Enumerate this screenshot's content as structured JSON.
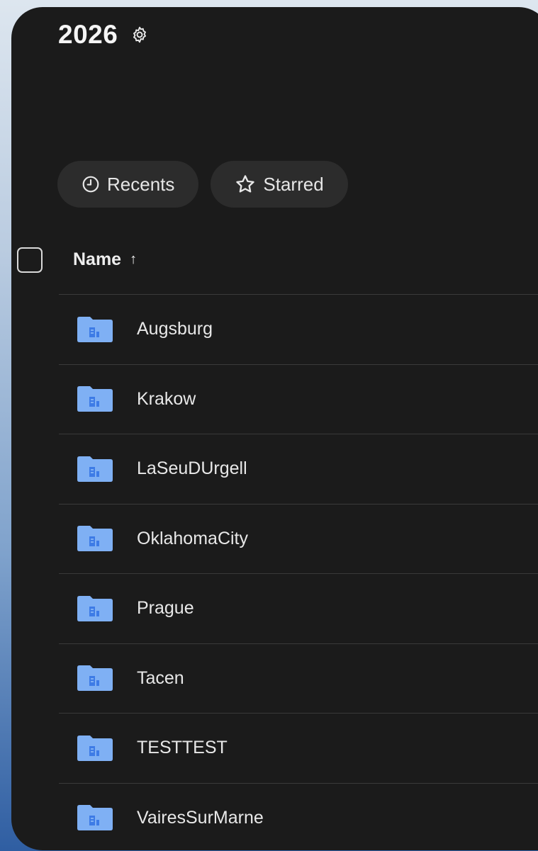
{
  "header": {
    "title": "2026",
    "settings_icon": "gear-icon"
  },
  "filters": [
    {
      "label": "Recents",
      "icon": "clock-icon"
    },
    {
      "label": "Starred",
      "icon": "star-icon"
    }
  ],
  "table": {
    "column_name": "Name",
    "sort_indicator": "↑",
    "rows": [
      {
        "name": "Augsburg",
        "icon": "shared-folder-icon"
      },
      {
        "name": "Krakow",
        "icon": "shared-folder-icon"
      },
      {
        "name": "LaSeuDUrgell",
        "icon": "shared-folder-icon"
      },
      {
        "name": "OklahomaCity",
        "icon": "shared-folder-icon"
      },
      {
        "name": "Prague",
        "icon": "shared-folder-icon"
      },
      {
        "name": "Tacen",
        "icon": "shared-folder-icon"
      },
      {
        "name": "TESTTEST",
        "icon": "shared-folder-icon"
      },
      {
        "name": "VairesSurMarne",
        "icon": "shared-folder-icon"
      }
    ]
  },
  "colors": {
    "panel_bg": "#1b1b1b",
    "pill_bg": "#2c2c2c",
    "folder_blue": "#7fb0f4",
    "folder_mark": "#3d7be6",
    "divider": "#3a3a3a",
    "text": "#e8e8e8"
  }
}
